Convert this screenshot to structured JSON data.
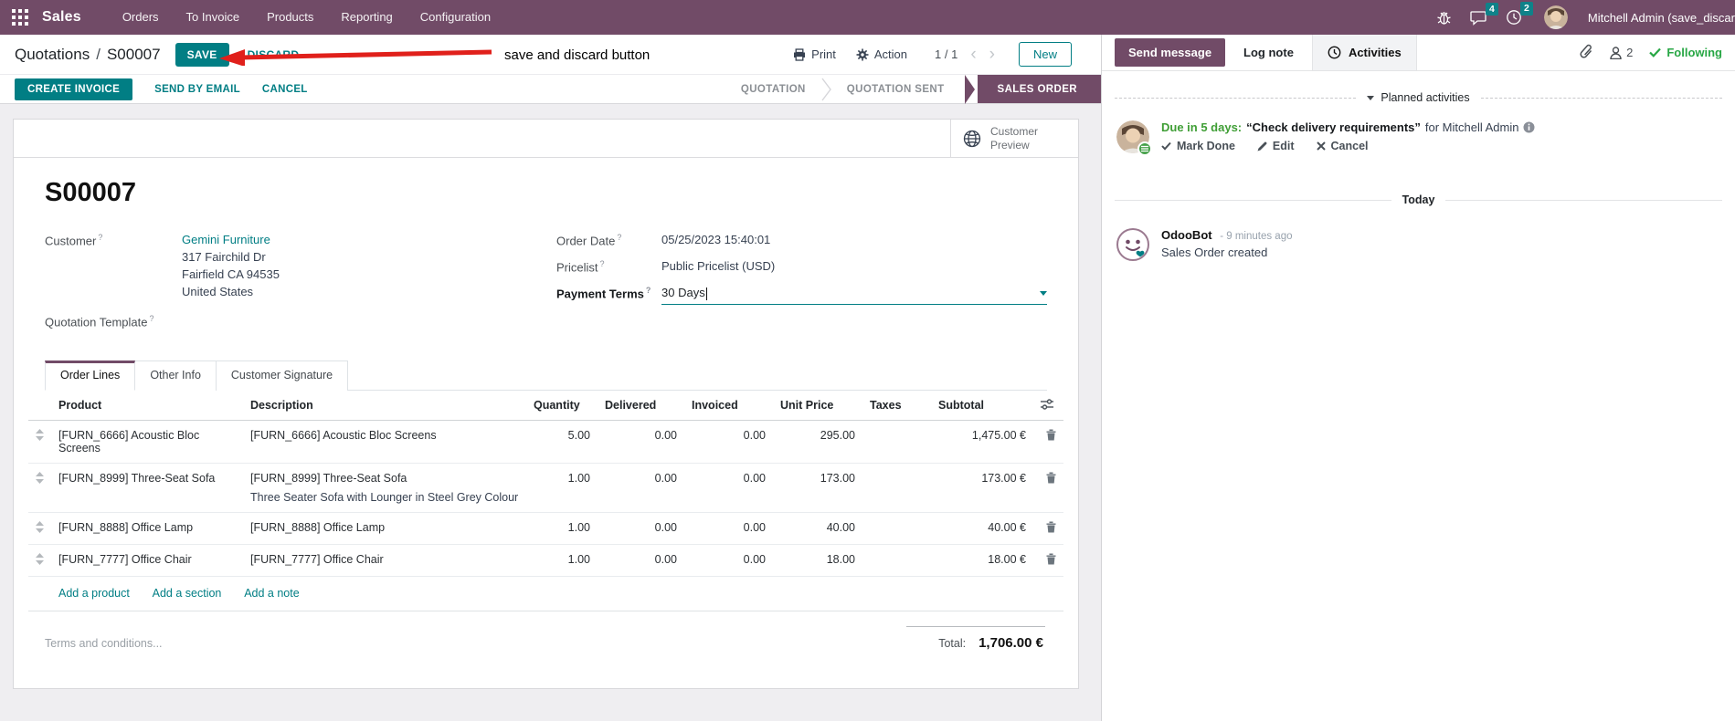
{
  "navbar": {
    "app_name": "Sales",
    "menus": [
      "Orders",
      "To Invoice",
      "Products",
      "Reporting",
      "Configuration"
    ],
    "message_count": "4",
    "activity_count": "2",
    "user_name": "Mitchell Admin (save_discar"
  },
  "control_panel": {
    "breadcrumb": {
      "parent": "Quotations",
      "separator": "/",
      "current": "S00007"
    },
    "save": "SAVE",
    "discard": "DISCARD",
    "print": "Print",
    "action": "Action",
    "pager": "1 / 1",
    "prev": "‹",
    "next": "›",
    "new": "New"
  },
  "annotation": {
    "label": "save and discard button"
  },
  "statusbar": {
    "create_invoice": "CREATE INVOICE",
    "send_by_email": "SEND BY EMAIL",
    "cancel": "CANCEL",
    "stages": [
      "QUOTATION",
      "QUOTATION SENT",
      "SALES ORDER"
    ],
    "active_stage": "SALES ORDER"
  },
  "sheet": {
    "preview": "Customer Preview",
    "title": "S00007",
    "help": "?",
    "customer": {
      "label": "Customer",
      "name": "Gemini Furniture",
      "address": [
        "317 Fairchild Dr",
        "Fairfield CA 94535",
        "United States"
      ]
    },
    "quotation_template": {
      "label": "Quotation Template"
    },
    "order_date": {
      "label": "Order Date",
      "value": "05/25/2023 15:40:01"
    },
    "pricelist": {
      "label": "Pricelist",
      "value": "Public Pricelist (USD)"
    },
    "payment_terms": {
      "label": "Payment Terms",
      "value": "30 Days"
    },
    "tabs": [
      "Order Lines",
      "Other Info",
      "Customer Signature"
    ],
    "order_lines": {
      "columns": [
        "Product",
        "Description",
        "Quantity",
        "Delivered",
        "Invoiced",
        "Unit Price",
        "Taxes",
        "Subtotal"
      ],
      "rows": [
        {
          "product": "[FURN_6666] Acoustic Bloc Screens",
          "description": "[FURN_6666] Acoustic Bloc Screens",
          "description2": "",
          "quantity": "5.00",
          "delivered": "0.00",
          "invoiced": "0.00",
          "unit_price": "295.00",
          "taxes": "",
          "subtotal": "1,475.00 €"
        },
        {
          "product": "[FURN_8999] Three-Seat Sofa",
          "description": "[FURN_8999] Three-Seat Sofa",
          "description2": "Three Seater Sofa with Lounger in Steel Grey Colour",
          "quantity": "1.00",
          "delivered": "0.00",
          "invoiced": "0.00",
          "unit_price": "173.00",
          "taxes": "",
          "subtotal": "173.00 €"
        },
        {
          "product": "[FURN_8888] Office Lamp",
          "description": "[FURN_8888] Office Lamp",
          "description2": "",
          "quantity": "1.00",
          "delivered": "0.00",
          "invoiced": "0.00",
          "unit_price": "40.00",
          "taxes": "",
          "subtotal": "40.00 €"
        },
        {
          "product": "[FURN_7777] Office Chair",
          "description": "[FURN_7777] Office Chair",
          "description2": "",
          "quantity": "1.00",
          "delivered": "0.00",
          "invoiced": "0.00",
          "unit_price": "18.00",
          "taxes": "",
          "subtotal": "18.00 €"
        }
      ],
      "add_product": "Add a product",
      "add_section": "Add a section",
      "add_note": "Add a note"
    },
    "terms_placeholder": "Terms and conditions...",
    "total": {
      "label": "Total:",
      "value": "1,706.00 €"
    }
  },
  "chatter": {
    "send_message": "Send message",
    "log_note": "Log note",
    "activities": "Activities",
    "followers": "2",
    "following": "Following",
    "planned": {
      "header": "Planned activities",
      "due": "Due in 5 days:",
      "summary": "“Check delivery requirements”",
      "assignee": "for Mitchell Admin",
      "mark_done": "Mark Done",
      "edit": "Edit",
      "cancel": "Cancel"
    },
    "today": "Today",
    "message": {
      "author": "OdooBot",
      "time": "- 9 minutes ago",
      "body": "Sales Order created"
    }
  },
  "colors": {
    "accent_teal": "#017E84",
    "brand_plum": "#714B67",
    "success_green": "#3f9e35",
    "annotation_red": "#e0201b"
  }
}
